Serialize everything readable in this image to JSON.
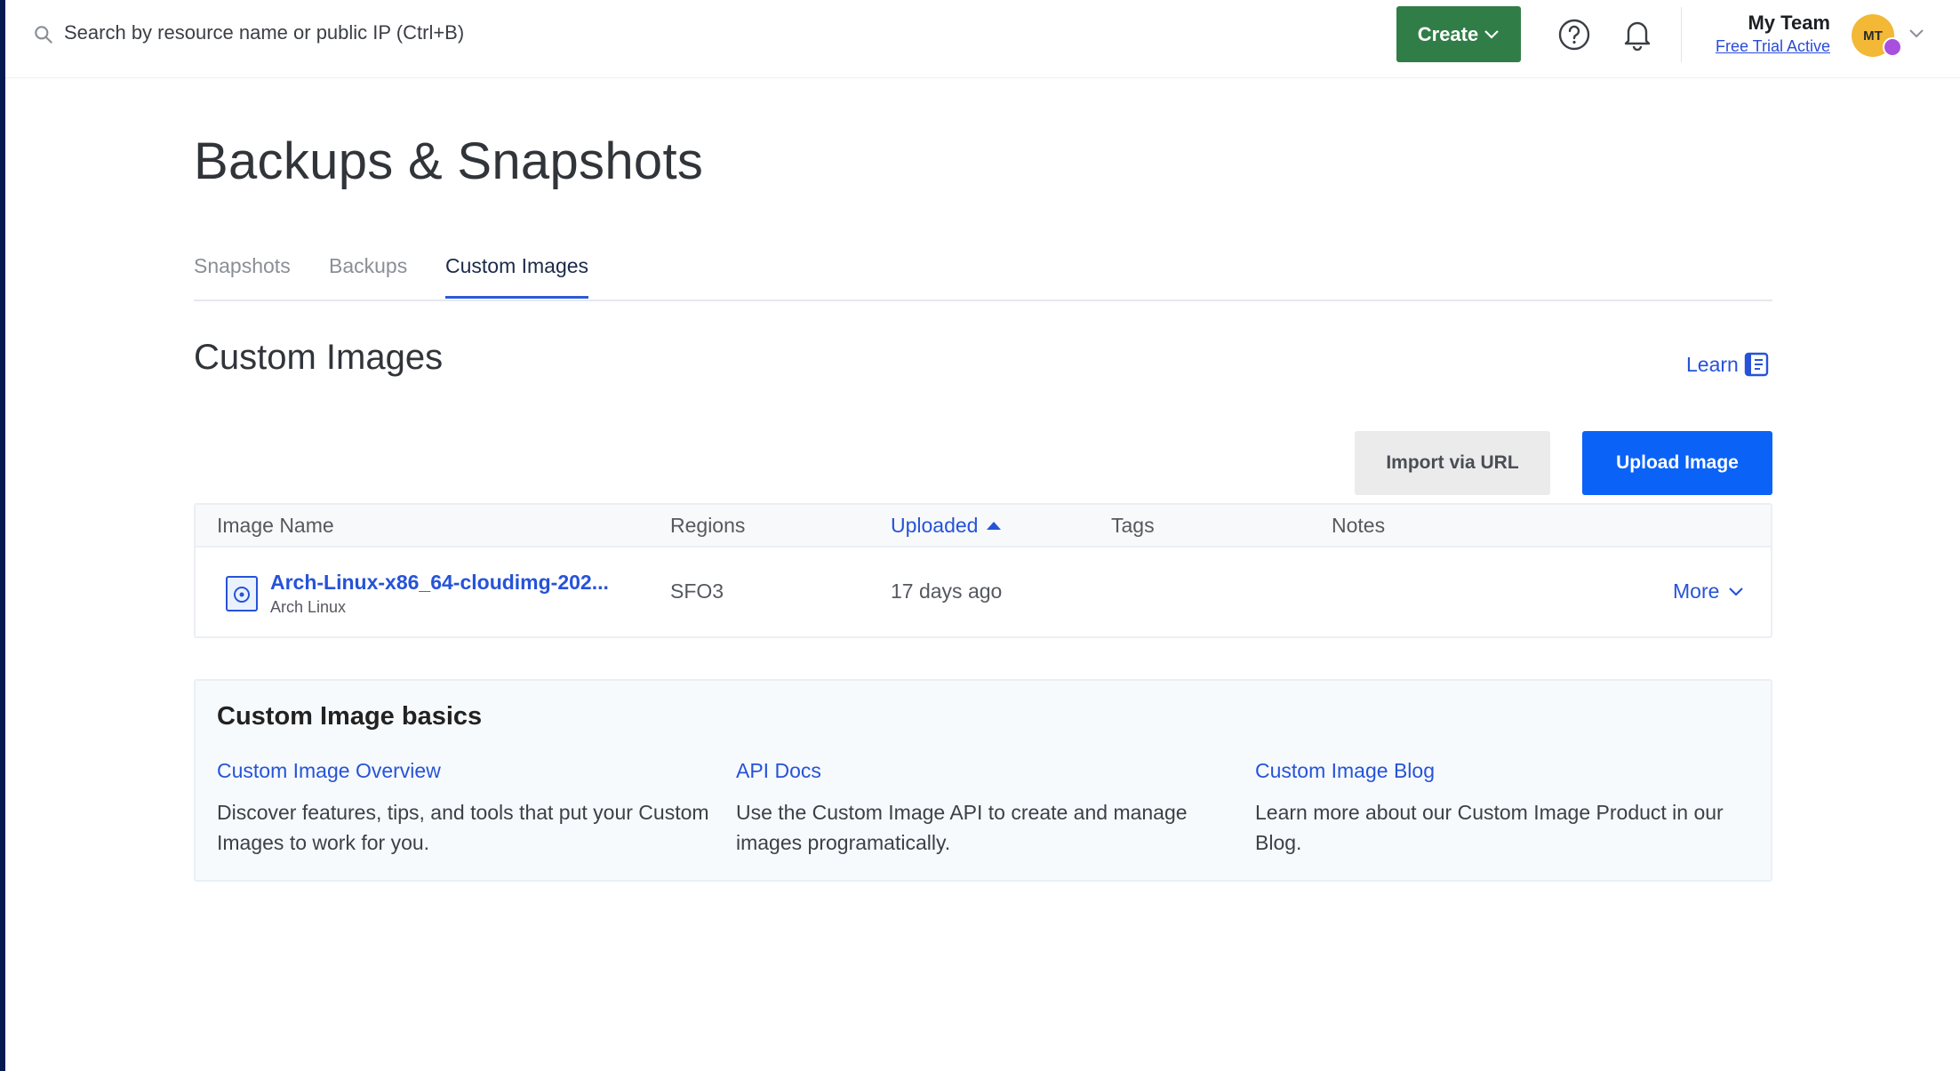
{
  "topbar": {
    "search_placeholder": "Search by resource name or public IP (Ctrl+B)",
    "create_label": "Create",
    "team_name": "My Team",
    "trial_status": "Free Trial Active",
    "avatar_initials": "MT"
  },
  "page": {
    "title": "Backups & Snapshots",
    "tabs": [
      {
        "label": "Snapshots",
        "active": false
      },
      {
        "label": "Backups",
        "active": false
      },
      {
        "label": "Custom Images",
        "active": true
      }
    ]
  },
  "section": {
    "title": "Custom Images",
    "learn_label": "Learn",
    "import_label": "Import via URL",
    "upload_label": "Upload Image"
  },
  "table": {
    "columns": [
      "Image Name",
      "Regions",
      "Uploaded",
      "Tags",
      "Notes"
    ],
    "rows": [
      {
        "name": "Arch-Linux-x86_64-cloudimg-202...",
        "distribution": "Arch Linux",
        "region": "SFO3",
        "uploaded": "17 days ago",
        "tags": "",
        "notes": "",
        "action": "More"
      }
    ]
  },
  "basics": {
    "title": "Custom Image basics",
    "items": [
      {
        "link": "Custom Image Overview",
        "desc": "Discover features, tips, and tools that put your Custom Images to work for you."
      },
      {
        "link": "API Docs",
        "desc": "Use the Custom Image API to create and manage images programatically."
      },
      {
        "link": "Custom Image Blog",
        "desc": "Learn more about our Custom Image Product in our Blog."
      }
    ]
  },
  "colors": {
    "primary": "#0b62f7",
    "link": "#2653d8",
    "create": "#317d47",
    "sidebar": "#031b4e"
  }
}
